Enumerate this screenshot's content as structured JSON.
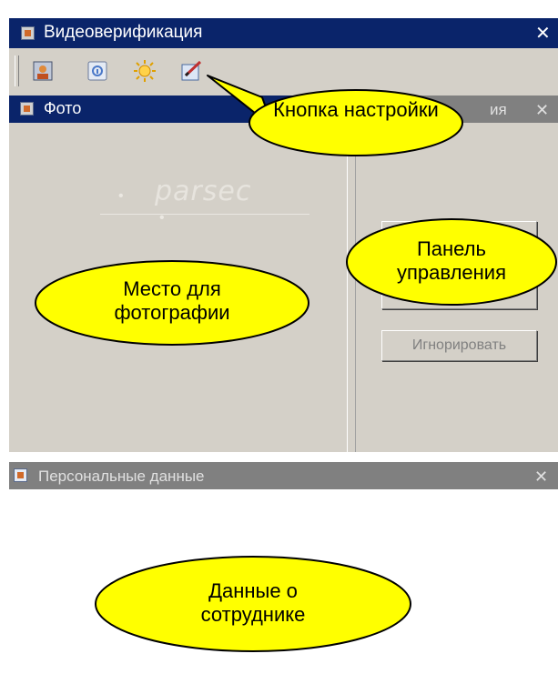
{
  "window": {
    "title": "Видеоверификация"
  },
  "toolbar": {
    "buttons": [
      {
        "name": "photo-button",
        "icon": "person-icon"
      },
      {
        "name": "personal-data-button",
        "icon": "info-card-icon"
      },
      {
        "name": "settings-button",
        "icon": "sun-gear-icon"
      },
      {
        "name": "edit-button",
        "icon": "pencil-icon"
      }
    ]
  },
  "photo_panel": {
    "title": "Фото",
    "logo": "parsec"
  },
  "control_panel": {
    "title_fragment": "ия",
    "ignore_label": "Игнорировать"
  },
  "personal_panel": {
    "title": "Персональные данные"
  },
  "callouts": {
    "settings_button": "Кнопка настройки",
    "control_panel": "Панель управления",
    "photo_place": "Место для фотографии",
    "employee_data": "Данные о сотруднике"
  },
  "colors": {
    "active_title": "#0a246a",
    "inactive_title": "#808080",
    "face": "#d4d0c8",
    "callout_fill": "#ffff00"
  }
}
